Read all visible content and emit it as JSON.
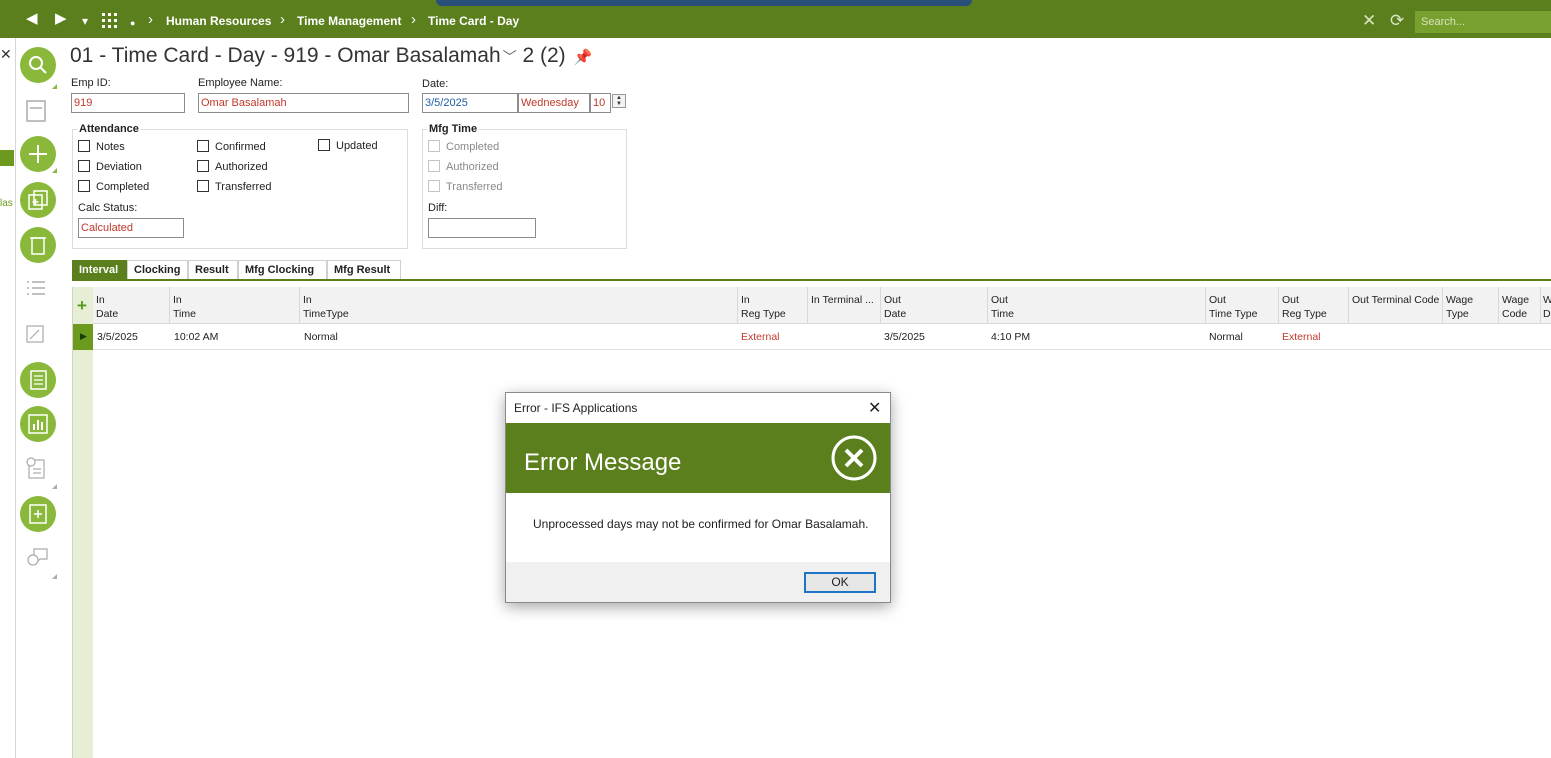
{
  "nav": {
    "back_icon": "◀",
    "forward_icon": "▶",
    "dropdown_icon": "▾",
    "apps_icon": "grid-icon",
    "dot": "●",
    "breadcrumbs": [
      "Human Resources",
      "Time Management",
      "Time Card - Day"
    ],
    "search_placeholder": "Search..."
  },
  "page": {
    "title": "01 - Time Card - Day - 919 - Omar Basalamah",
    "record_count": "2 (2)"
  },
  "header": {
    "emp_id_label": "Emp ID:",
    "emp_id": "919",
    "employee_name_label": "Employee Name:",
    "employee_name": "Omar Basalamah",
    "date_label": "Date:",
    "date": "3/5/2025",
    "weekday": "Wednesday",
    "week_number": "10"
  },
  "attendance": {
    "title": "Attendance",
    "checks": [
      {
        "label": "Notes",
        "checked": false
      },
      {
        "label": "Deviation",
        "checked": false
      },
      {
        "label": "Completed",
        "checked": false
      },
      {
        "label": "Confirmed",
        "checked": false
      },
      {
        "label": "Authorized",
        "checked": false
      },
      {
        "label": "Transferred",
        "checked": false
      },
      {
        "label": "Updated",
        "checked": false
      }
    ],
    "calc_status_label": "Calc Status:",
    "calc_status": "Calculated"
  },
  "mfg": {
    "title": "Mfg Time",
    "checks": [
      {
        "label": "Completed",
        "checked": false
      },
      {
        "label": "Authorized",
        "checked": false
      },
      {
        "label": "Transferred",
        "checked": false
      }
    ],
    "diff_label": "Diff:",
    "diff": ""
  },
  "tabs": [
    "Interval",
    "Clocking",
    "Result",
    "Mfg Clocking",
    "Mfg Result"
  ],
  "grid": {
    "columns": [
      {
        "l1": "In",
        "l2": "Date"
      },
      {
        "l1": "In",
        "l2": "Time"
      },
      {
        "l1": "In",
        "l2": "TimeType"
      },
      {
        "l1": "In",
        "l2": "Reg Type"
      },
      {
        "l1": "In Terminal ...",
        "l2": ""
      },
      {
        "l1": "Out",
        "l2": "Date"
      },
      {
        "l1": "Out",
        "l2": "Time"
      },
      {
        "l1": "Out",
        "l2": "Time Type"
      },
      {
        "l1": "Out",
        "l2": "Reg Type"
      },
      {
        "l1": "Out Terminal Code",
        "l2": ""
      },
      {
        "l1": "Wage",
        "l2": "Type"
      },
      {
        "l1": "Wage",
        "l2": "Code"
      },
      {
        "l1": "W",
        "l2": "De"
      }
    ],
    "rows": [
      {
        "in_date": "3/5/2025",
        "in_time": "10:02 AM",
        "in_timetype": "Normal",
        "in_regtype": "External",
        "out_date": "3/5/2025",
        "out_time": "4:10 PM",
        "out_timetype": "Normal",
        "out_regtype": "External"
      }
    ]
  },
  "dialog": {
    "title": "Error - IFS Applications",
    "heading": "Error Message",
    "message": "Unprocessed days may not be confirmed for Omar Basalamah.",
    "ok_label": "OK"
  },
  "side": {
    "close": "✕",
    "label": "las"
  },
  "colors": {
    "brand_green": "#5a7f1c",
    "rail_green": "#8ab83a",
    "error_red": "#c0392b",
    "date_blue": "#1f5fa6"
  }
}
